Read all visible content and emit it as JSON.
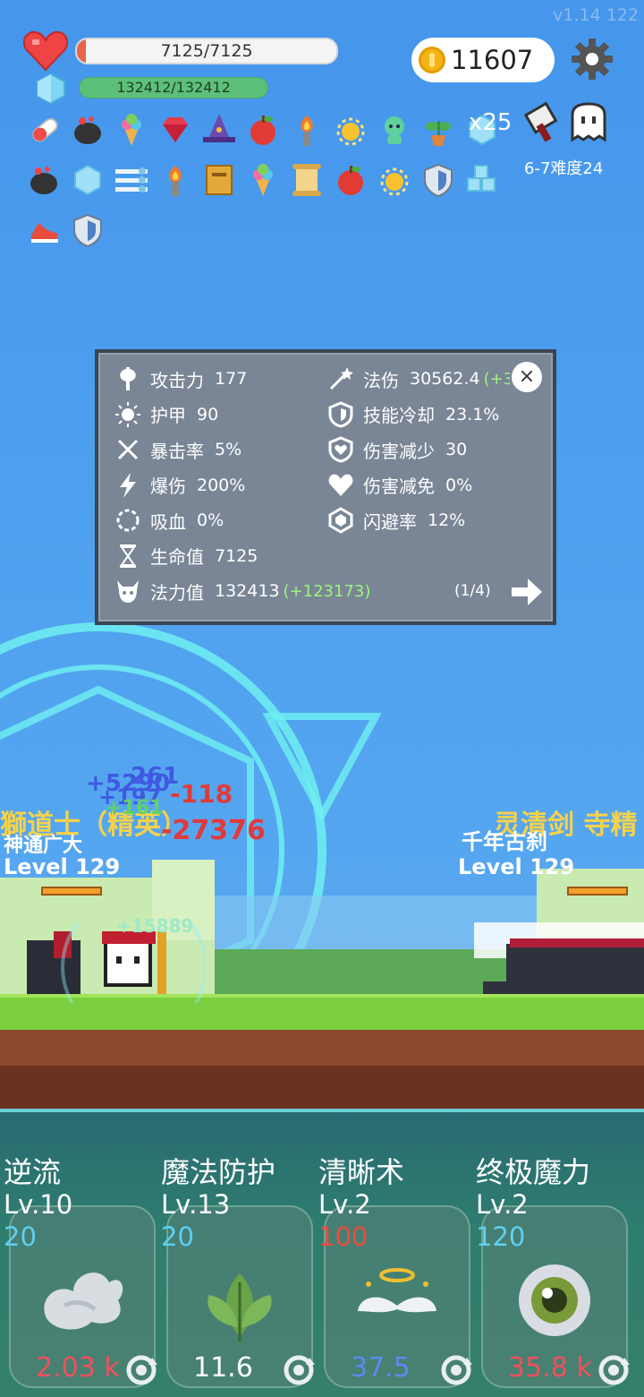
{
  "version": "v1.14 122",
  "hud": {
    "hp_text": "7125/7125",
    "mp_text": "132412/132412",
    "coins": "11607",
    "settings_icon": "gear-icon"
  },
  "buffs": {
    "row1": [
      "capsule-icon",
      "cauldron-icon",
      "ice-cream-icon",
      "ruby-icon",
      "wizard-hat-icon",
      "apple-icon",
      "torch-icon",
      "sun-orb-icon",
      "spirit-icon",
      "potted-plant-icon",
      "ice-cube-icon"
    ],
    "row2": [
      "cauldron-icon",
      "ice-cube-icon",
      "speed-lines-icon",
      "torch-icon",
      "spellbook-icon",
      "ice-cream-icon",
      "scroll-icon",
      "apple-icon",
      "sun-orb-icon",
      "shield-icon",
      "ice-cubes-icon"
    ],
    "row3": [
      "running-shoe-icon",
      "shield-icon"
    ],
    "stack_count": "x25"
  },
  "stage": {
    "label": "6-7难度24"
  },
  "stats": {
    "left": [
      {
        "icon": "axe-icon",
        "label": "攻击力",
        "value": "177"
      },
      {
        "icon": "sun-icon",
        "label": "护甲",
        "value": "90"
      },
      {
        "icon": "crit-icon",
        "label": "暴击率",
        "value": "5%"
      },
      {
        "icon": "lightning-icon",
        "label": "爆伤",
        "value": "200%"
      },
      {
        "icon": "lifesteal-icon",
        "label": "吸血",
        "value": "0%"
      },
      {
        "icon": "hourglass-icon",
        "label": "生命值",
        "value": "7125"
      },
      {
        "icon": "demon-skull-icon",
        "label": "法力值",
        "value": "132413",
        "bonus": "(+123173)"
      }
    ],
    "right": [
      {
        "icon": "magic-wand-icon",
        "label": "法伤",
        "value": "30562.4",
        "bonus": "(+3"
      },
      {
        "icon": "shield-outline-icon",
        "label": "技能冷却",
        "value": "23.1%"
      },
      {
        "icon": "heart-shield-icon",
        "label": "伤害减少",
        "value": "30"
      },
      {
        "icon": "heart-icon",
        "label": "伤害减免",
        "value": "0%"
      },
      {
        "icon": "hexagon-icon",
        "label": "闪避率",
        "value": "12%"
      }
    ],
    "page": "(1/4)",
    "close_label": "×"
  },
  "battle": {
    "dmg_numbers": [
      "+5290",
      "+197",
      "261",
      "-118",
      "+161",
      "-27376",
      "+15889"
    ],
    "player_title": "獅道士（精英）",
    "player_sub": "神通广大",
    "player_level": "Level 129",
    "enemy_title": "灵清剑 寺精",
    "enemy_sub": "千年古刹",
    "enemy_level": "Level 129"
  },
  "skills": [
    {
      "name": "逆流",
      "level": "Lv.10",
      "cost": "20",
      "cost_color": "#5fd0f0",
      "price": "2.03 k",
      "price_color": "#f0505a",
      "icon": "wind-cloud-icon"
    },
    {
      "name": "魔法防护",
      "level": "Lv.13",
      "cost": "20",
      "cost_color": "#5fd0f0",
      "price": "11.6",
      "price_color": "#ffffff",
      "icon": "leaves-icon"
    },
    {
      "name": "清晰术",
      "level": "Lv.2",
      "cost": "100",
      "cost_color": "#f04a3c",
      "price": "37.5",
      "price_color": "#5a8af0",
      "icon": "angel-halo-icon"
    },
    {
      "name": "终极魔力",
      "level": "Lv.2",
      "cost": "120",
      "cost_color": "#5fd0f0",
      "price": "35.8 k",
      "price_color": "#f0505a",
      "icon": "eye-orb-icon"
    }
  ]
}
